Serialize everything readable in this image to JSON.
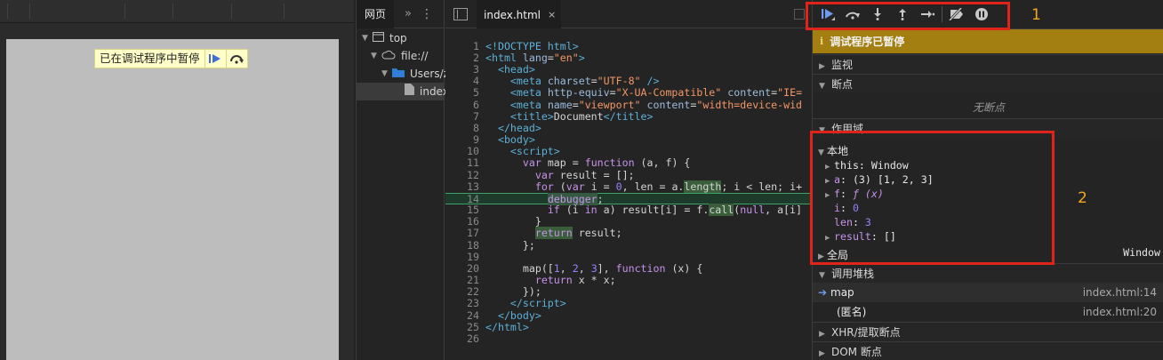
{
  "page_pane": {
    "paused_overlay": {
      "text": "已在调试程序中暂停"
    }
  },
  "navigator": {
    "tab_label": "网页",
    "more_label": "»",
    "kebab_label": "⋮",
    "tree": [
      {
        "label": "top",
        "icon": "frame-icon"
      },
      {
        "label": "file://",
        "icon": "cloud-icon"
      },
      {
        "label": "Users/z",
        "icon": "folder-icon"
      },
      {
        "label": "index",
        "icon": "file-icon"
      }
    ]
  },
  "editor": {
    "tab_label": "index.html",
    "tab_close": "×",
    "line_numbers": [
      "1",
      "2",
      "3",
      "4",
      "5",
      "6",
      "7",
      "8",
      "9",
      "10",
      "11",
      "12",
      "13",
      "14",
      "15",
      "16",
      "17",
      "18",
      "19",
      "20",
      "21",
      "22",
      "23",
      "24",
      "25",
      "26"
    ]
  },
  "debugger": {
    "paused_banner": "调试程序已暂停",
    "sections": {
      "watch": "监视",
      "breakpoints": "断点",
      "no_breakpoints": "无断点",
      "scope": "作用域",
      "local": "本地",
      "global": "全局",
      "global_value": "Window",
      "call_stack": "调用堆栈",
      "xhr": "XHR/提取断点",
      "dom": "DOM 断点"
    },
    "scope_vars": {
      "this_key": "this",
      "this_val": "Window",
      "a_key": "a",
      "a_val": "(3) [1, 2, 3]",
      "f_key": "f",
      "f_val": "ƒ (x)",
      "i_key": "i",
      "i_val": "0",
      "len_key": "len",
      "len_val": "3",
      "result_key": "result",
      "result_val": "[]"
    },
    "call_stack": [
      {
        "name": "map",
        "location": "index.html:14"
      },
      {
        "name": "(匿名)",
        "location": "index.html:20"
      }
    ]
  },
  "annotations": {
    "label_1": "1",
    "label_2": "2"
  },
  "colors": {
    "annotation_box": "#e0241b",
    "annotation_label": "#f2a81d",
    "paused_banner": "#a37f12",
    "execution_line": "#1d3a2b"
  }
}
